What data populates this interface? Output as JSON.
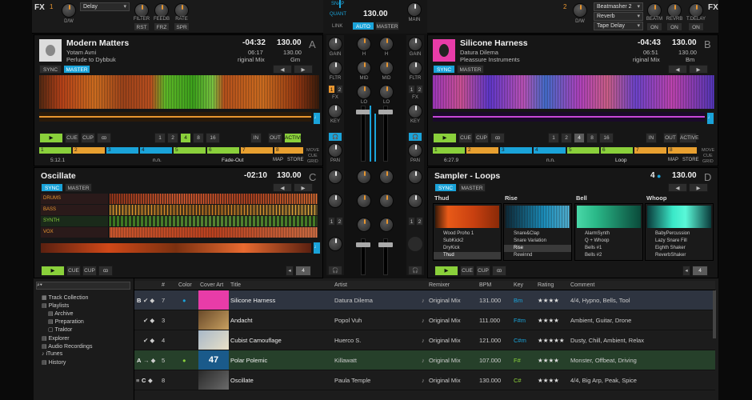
{
  "fx_left": {
    "label": "FX",
    "unit": "1",
    "knob1": "D/W",
    "effect": "Delay",
    "knobs": [
      "FILTER",
      "FEEDB",
      "RATE"
    ],
    "buttons": [
      "RST",
      "FRZ",
      "SPR"
    ]
  },
  "fx_right": {
    "label": "FX",
    "unit": "2",
    "knob1": "D/W",
    "effects": [
      "Beatmasher 2",
      "Reverb",
      "Tape Delay"
    ],
    "knobs": [
      "BEATM",
      "REVRB",
      "T.DELAY"
    ],
    "buttons": [
      "ON",
      "ON",
      "ON"
    ]
  },
  "master": {
    "snap": "SNAP",
    "quant": "QUANT",
    "bpm": "130.00",
    "link": "LINK",
    "auto": "AUTO",
    "master": "MASTER",
    "main": "MAIN"
  },
  "deck_a": {
    "title": "Modern Matters",
    "artist": "Yotam Avni",
    "album": "Perlude to Dybbuk",
    "remain": "-04:32",
    "total": "06:17",
    "mix": "riginal Mix",
    "bpm": "130.00",
    "bpm2": "130.00",
    "key": "Gm",
    "letter": "A",
    "sync": "SYNC",
    "master": "MASTER",
    "cue": "CUE",
    "cup": "CUP",
    "loops": [
      "1",
      "2",
      "4",
      "8",
      "16"
    ],
    "in": "IN",
    "out": "OUT",
    "active": "ACTIVE",
    "pos": "5:12.1",
    "nn": "n.n.",
    "fade": "Fade-Out",
    "map": "MAP",
    "store": "STORE",
    "move": "MOVE",
    "cue2": "CUE",
    "grid": "GRID"
  },
  "deck_b": {
    "title": "Silicone Harness",
    "artist": "Datura Dilema",
    "album": "Pleassure Instruments",
    "remain": "-04:43",
    "total": "06:51",
    "mix": "riginal Mix",
    "bpm": "130.00",
    "bpm2": "130.00",
    "key": "Bm",
    "letter": "B",
    "sync": "SYNC",
    "master": "MASTER",
    "cue": "CUE",
    "cup": "CUP",
    "loops": [
      "1",
      "2",
      "4",
      "8",
      "16"
    ],
    "in": "IN",
    "out": "OUT",
    "active": "ACTIVE",
    "pos": "6:27.9",
    "nn": "n.n.",
    "loop": "Loop",
    "map": "MAP",
    "store": "STORE",
    "move": "MOVE",
    "cue2": "CUE",
    "grid": "GRID"
  },
  "deck_c": {
    "title": "Oscillate",
    "remain": "-02:10",
    "bpm": "130.00",
    "letter": "C",
    "sync": "SYNC",
    "master": "MASTER",
    "stems": [
      "DRUMS",
      "BASS",
      "SYNTH",
      "VOX"
    ],
    "cue": "CUE",
    "cup": "CUP",
    "loop": "4"
  },
  "deck_d": {
    "title": "Sampler - Loops",
    "count": "4",
    "bpm": "130.00",
    "letter": "D",
    "sync": "SYNC",
    "master": "MASTER",
    "cue": "CUE",
    "cup": "CUP",
    "loop": "4",
    "slots": [
      {
        "name": "Thud",
        "items": [
          "Wood Proho 1",
          "SubKick2",
          "DryKick",
          "Thud"
        ]
      },
      {
        "name": "Rise",
        "items": [
          "Snare&Clap",
          "Snare Variation",
          "Rise",
          "Rewinnd"
        ]
      },
      {
        "name": "Bell",
        "items": [
          "AlarmSynth",
          "Q + Whoop",
          "Bells #1",
          "Bells #2"
        ]
      },
      {
        "name": "Whoop",
        "items": [
          "BabyPercussion",
          "Lazy Snare Fill",
          "Eighth Shaker",
          "ReverbShaker"
        ]
      }
    ]
  },
  "mixer": {
    "gain": "GAIN",
    "fltr": "FLTR",
    "fx": "FX",
    "key": "KEY",
    "pan": "PAN",
    "h": "H",
    "mid": "MID",
    "lo": "LO",
    "one": "1",
    "two": "2"
  },
  "search": {
    "placeholder": "⌕▾"
  },
  "tree": [
    "Track Collection",
    "Playlists",
    "Archive",
    "Preparation",
    "Traktor",
    "Explorer",
    "Audio Recordings",
    "iTunes",
    "History"
  ],
  "columns": [
    "#",
    "Color",
    "Cover Art",
    "Title",
    "Artist",
    "Remixer",
    "BPM",
    "Key",
    "Rating",
    "Comment"
  ],
  "rows": [
    {
      "deck": "B",
      "n": "7",
      "title": "Silicone Harness",
      "artist": "Datura Dilema",
      "remixer": "Original Mix",
      "bpm": "131.000",
      "key": "Bm",
      "rating": "★★★★",
      "comment": "4/4, Hypno, Bells, Tool"
    },
    {
      "deck": "",
      "n": "3",
      "title": "Andacht",
      "artist": "Popol Vuh",
      "remixer": "Original Mix",
      "bpm": "111.000",
      "key": "F#m",
      "rating": "★★★★",
      "comment": "Ambient, Guitar, Drone"
    },
    {
      "deck": "",
      "n": "4",
      "title": "Cubist Camouflage",
      "artist": "Huerco S.",
      "remixer": "Original Mix",
      "bpm": "121.000",
      "key": "C#m",
      "rating": "★★★★★",
      "comment": "Dusty, Chill, Ambient, Relax"
    },
    {
      "deck": "A",
      "n": "5",
      "title": "Polar Polemic",
      "artist": "Killawatt",
      "remixer": "Original Mix",
      "bpm": "107.000",
      "key": "F#",
      "rating": "★★★★",
      "comment": "Monster, Offbeat, Driving"
    },
    {
      "deck": "C",
      "n": "8",
      "title": "Oscillate",
      "artist": "Paula Temple",
      "remixer": "Original Mix",
      "bpm": "130.000",
      "key": "C#",
      "rating": "★★★★",
      "comment": "4/4, Big Arp, Peak, Spice"
    }
  ],
  "cover_text": "47"
}
